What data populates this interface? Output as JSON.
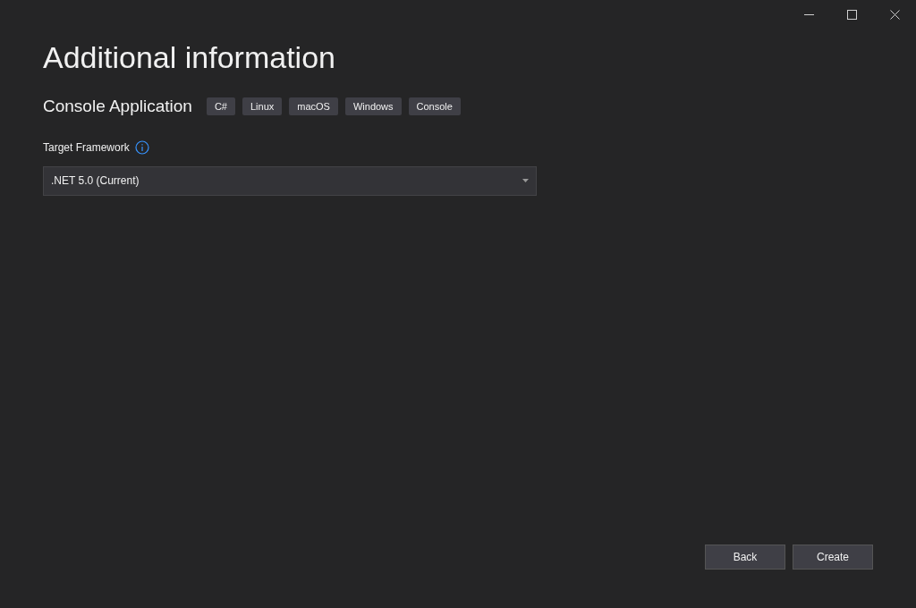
{
  "title": "Additional information",
  "template": {
    "name": "Console Application",
    "tags": [
      "C#",
      "Linux",
      "macOS",
      "Windows",
      "Console"
    ]
  },
  "target_framework": {
    "label": "Target Framework",
    "value": ".NET 5.0 (Current)"
  },
  "buttons": [
    {
      "label": "Back"
    },
    {
      "label": "Create"
    }
  ]
}
